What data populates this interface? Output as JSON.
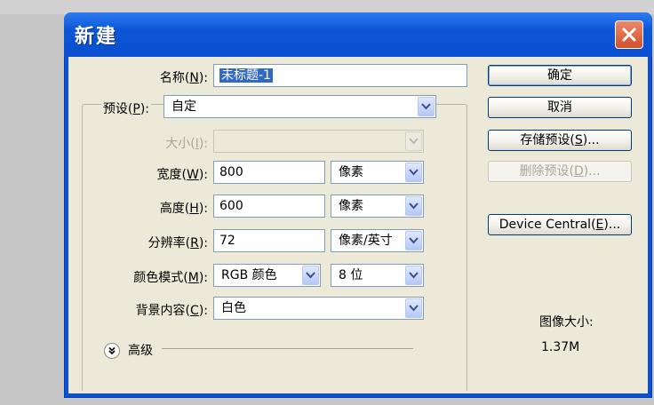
{
  "dialog": {
    "title": "新建",
    "colors": {
      "title_bar": "#0a50d8",
      "client_bg": "#ece9d8",
      "selection": "#316ac5"
    }
  },
  "fields": {
    "name": {
      "label_pre": "名称(",
      "hotkey": "N",
      "label_post": "):",
      "value": "未标题-1"
    },
    "preset": {
      "label_pre": "预设(",
      "hotkey": "P",
      "label_post": "):",
      "value": "自定"
    },
    "size": {
      "label_pre": "大小(",
      "hotkey": "I",
      "label_post": "):",
      "value": ""
    },
    "width": {
      "label_pre": "宽度(",
      "hotkey": "W",
      "label_post": "):",
      "value": "800",
      "unit": "像素"
    },
    "height": {
      "label_pre": "高度(",
      "hotkey": "H",
      "label_post": "):",
      "value": "600",
      "unit": "像素"
    },
    "resolution": {
      "label_pre": "分辨率(",
      "hotkey": "R",
      "label_post": "):",
      "value": "72",
      "unit": "像素/英寸"
    },
    "color_mode": {
      "label_pre": "颜色模式(",
      "hotkey": "M",
      "label_post": "):",
      "value": "RGB 颜色",
      "depth": "8 位"
    },
    "background": {
      "label_pre": "背景内容(",
      "hotkey": "C",
      "label_post": "):",
      "value": "白色"
    }
  },
  "advanced": {
    "label": "高级",
    "icon": "double-chevron-down-icon"
  },
  "buttons": {
    "ok": "确定",
    "cancel": "取消",
    "save_preset": {
      "pre": "存储预设(",
      "hotkey": "S",
      "post": ")..."
    },
    "delete_preset": {
      "pre": "删除预设(",
      "hotkey": "D",
      "post": ")..."
    },
    "device_central": {
      "pre": "Device Central(",
      "hotkey": "E",
      "post": ")..."
    }
  },
  "image_size": {
    "label": "图像大小:",
    "value": "1.37M"
  }
}
